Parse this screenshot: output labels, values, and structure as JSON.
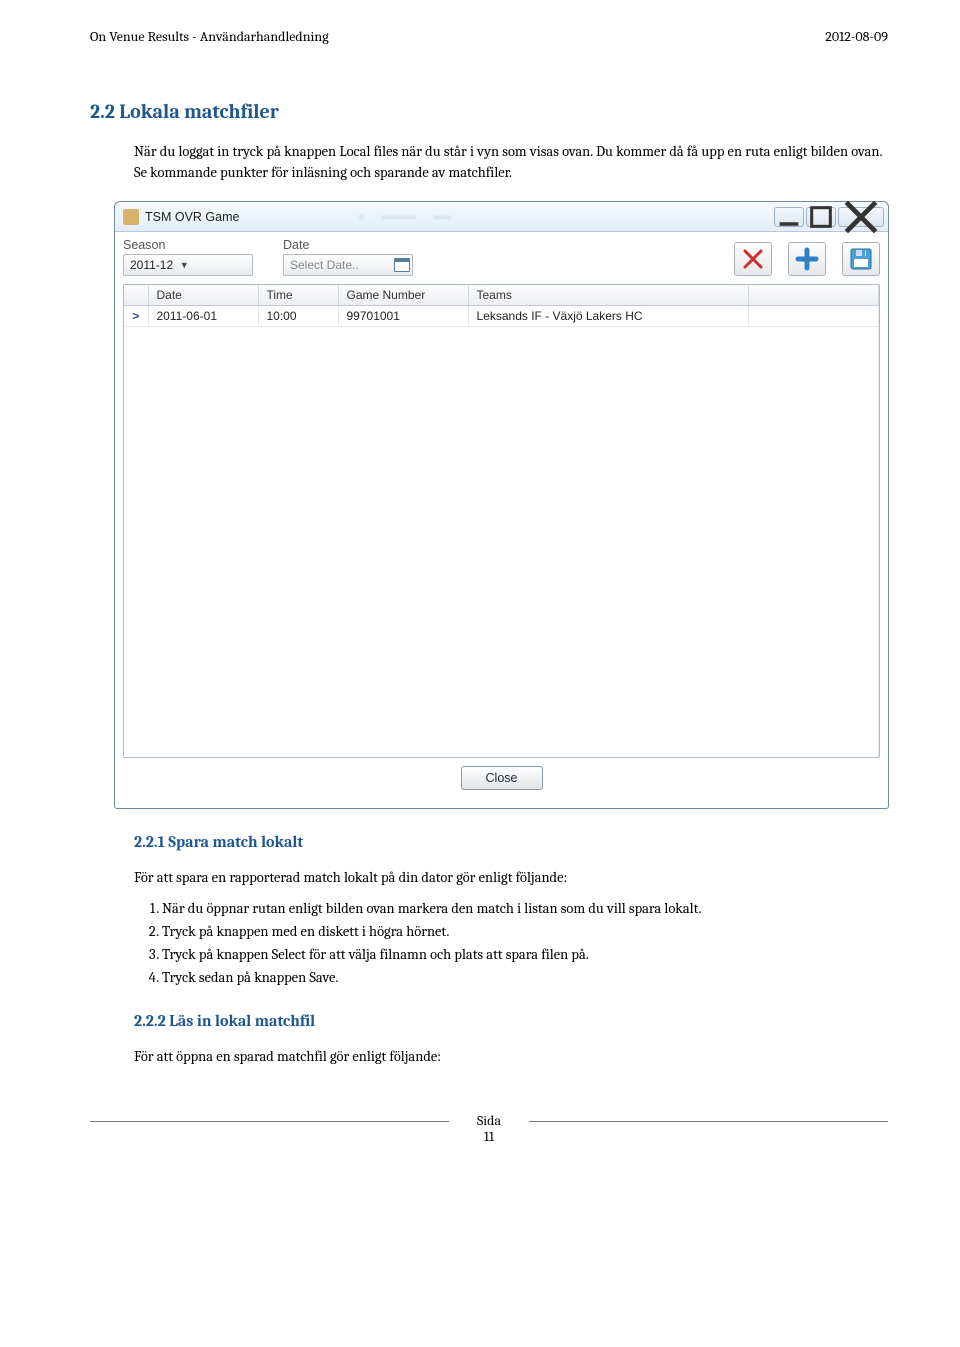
{
  "header": {
    "left": "On Venue Results - Användarhandledning",
    "right": "2012-08-09"
  },
  "section": {
    "heading22": "2.2   Lokala matchfiler",
    "para1": "När du loggat in tryck på knappen Local files när du står i vyn som visas ovan. Du kommer då få upp en ruta enligt bilden ovan. Se kommande punkter för inläsning och sparande av matchfiler.",
    "heading221": "2.2.1    Spara match lokalt",
    "para2": "För att spara en rapporterad match lokalt på din dator gör enligt följande:",
    "list": [
      "När du öppnar rutan enligt bilden ovan markera den match i listan som du vill spara lokalt.",
      "Tryck på knappen med en diskett i högra hörnet.",
      "Tryck på knappen Select för att välja filnamn och plats att spara filen på.",
      "Tryck sedan på knappen Save."
    ],
    "heading222": "2.2.2    Läs in lokal matchfil",
    "para3": "För att öppna en sparad matchfil gör enligt följande:"
  },
  "window": {
    "title": "TSM OVR Game",
    "season_label": "Season",
    "season_value": "2011-12",
    "date_label": "Date",
    "date_placeholder": "Select Date..",
    "columns": [
      "",
      "Date",
      "Time",
      "Game Number",
      "Teams",
      ""
    ],
    "row": {
      "indicator": ">",
      "date": "2011-06-01",
      "time": "10:00",
      "game_number": "99701001",
      "teams": "Leksands IF - Växjö Lakers HC"
    },
    "close_label": "Close"
  },
  "footer": {
    "label": "Sida",
    "page": "11"
  }
}
